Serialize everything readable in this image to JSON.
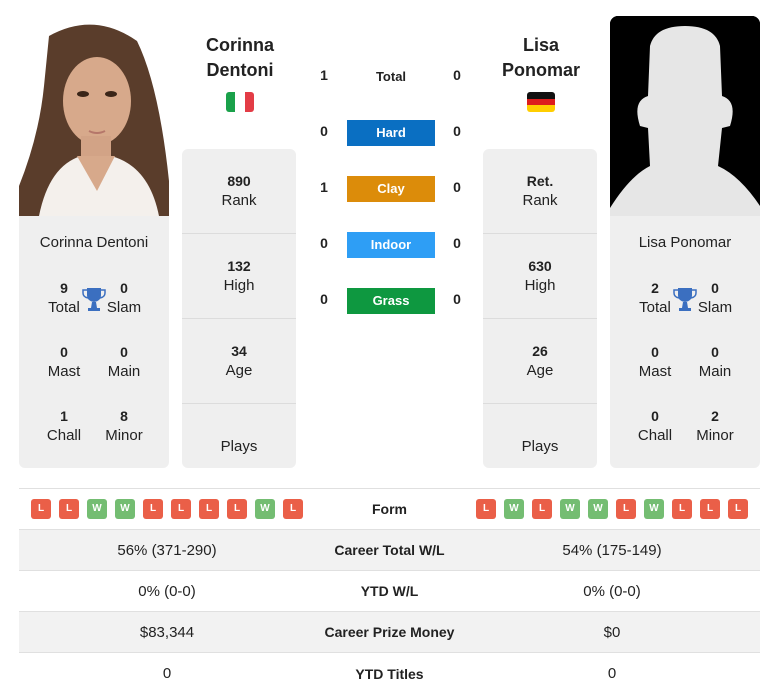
{
  "colors": {
    "hard": "#0a6fc2",
    "clay": "#dc8c0a",
    "indoor": "#2e9ef5",
    "grass": "#0e9840",
    "loss": "#ea5f48",
    "win": "#74bd72"
  },
  "player1": {
    "name_line1": "Corinna",
    "name_line2": "Dentoni",
    "full_name": "Corinna Dentoni",
    "flag": "italy-flag",
    "rank": "890",
    "rank_label": "Rank",
    "high": "132",
    "high_label": "High",
    "age": "34",
    "age_label": "Age",
    "plays_label": "Plays",
    "titles": {
      "total": "9",
      "total_label": "Total",
      "slam": "0",
      "slam_label": "Slam",
      "mast": "0",
      "mast_label": "Mast",
      "main": "0",
      "main_label": "Main",
      "chall": "1",
      "chall_label": "Chall",
      "minor": "8",
      "minor_label": "Minor"
    }
  },
  "player2": {
    "name_line1": "Lisa",
    "name_line2": "Ponomar",
    "full_name": "Lisa Ponomar",
    "flag": "germany-flag",
    "rank": "Ret.",
    "rank_label": "Rank",
    "high": "630",
    "high_label": "High",
    "age": "26",
    "age_label": "Age",
    "plays_label": "Plays",
    "titles": {
      "total": "2",
      "total_label": "Total",
      "slam": "0",
      "slam_label": "Slam",
      "mast": "0",
      "mast_label": "Mast",
      "main": "0",
      "main_label": "Main",
      "chall": "0",
      "chall_label": "Chall",
      "minor": "2",
      "minor_label": "Minor"
    }
  },
  "h2h": {
    "total": {
      "label": "Total",
      "p1": "1",
      "p2": "0"
    },
    "hard": {
      "label": "Hard",
      "p1": "0",
      "p2": "0"
    },
    "clay": {
      "label": "Clay",
      "p1": "1",
      "p2": "0"
    },
    "indoor": {
      "label": "Indoor",
      "p1": "0",
      "p2": "0"
    },
    "grass": {
      "label": "Grass",
      "p1": "0",
      "p2": "0"
    }
  },
  "comparison": {
    "form_label": "Form",
    "p1_form": [
      "L",
      "L",
      "W",
      "W",
      "L",
      "L",
      "L",
      "L",
      "W",
      "L"
    ],
    "p2_form": [
      "L",
      "W",
      "L",
      "W",
      "W",
      "L",
      "W",
      "L",
      "L",
      "L"
    ],
    "rows": [
      {
        "label": "Career Total W/L",
        "p1": "56% (371-290)",
        "p2": "54% (175-149)"
      },
      {
        "label": "YTD W/L",
        "p1": "0% (0-0)",
        "p2": "0% (0-0)"
      },
      {
        "label": "Career Prize Money",
        "p1": "$83,344",
        "p2": "$0"
      },
      {
        "label": "YTD Titles",
        "p1": "0",
        "p2": "0"
      }
    ]
  }
}
